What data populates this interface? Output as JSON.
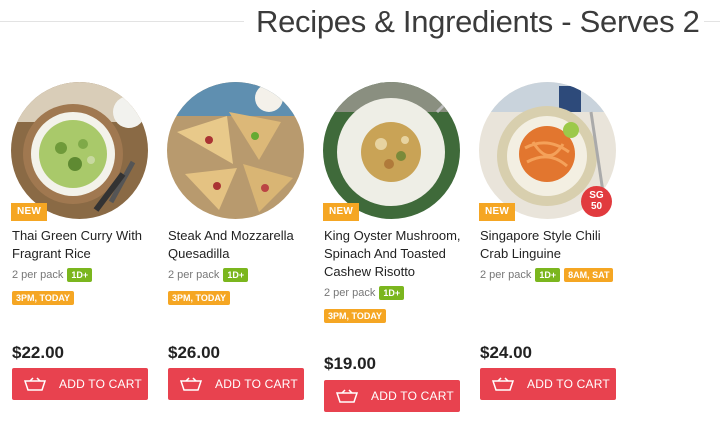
{
  "header": {
    "title": "Recipes & Ingredients - Serves 2"
  },
  "products": [
    {
      "badge": "NEW",
      "name": "Thai Green Curry With Fragrant Rice",
      "per_pack": "2 per pack",
      "lead_tag": "1D+",
      "slot_tag": "3PM, TODAY",
      "price": "$22.00",
      "cart_label": "ADD TO CART",
      "image": "thai-green-curry"
    },
    {
      "badge": "",
      "name": "Steak And Mozzarella Quesadilla",
      "per_pack": "2 per pack",
      "lead_tag": "1D+",
      "slot_tag": "3PM, TODAY",
      "price": "$26.00",
      "cart_label": "ADD TO CART",
      "image": "steak-quesadilla"
    },
    {
      "badge": "NEW",
      "name": "King Oyster Mushroom, Spinach And Toasted Cashew Risotto",
      "per_pack": "2 per pack",
      "lead_tag": "1D+",
      "slot_tag": "3PM, TODAY",
      "price": "$19.00",
      "cart_label": "ADD TO CART",
      "image": "mushroom-risotto"
    },
    {
      "badge": "NEW",
      "sg_badge": "SG 50",
      "name": "Singapore Style Chili Crab Linguine",
      "per_pack": "2 per pack",
      "lead_tag": "1D+",
      "slot_tag": "8AM, SAT",
      "price": "$24.00",
      "cart_label": "ADD TO CART",
      "image": "chili-crab-linguine"
    }
  ],
  "colors": {
    "accent_red": "#e8424f",
    "badge_orange": "#f5a623",
    "tag_green": "#7bb61e"
  }
}
